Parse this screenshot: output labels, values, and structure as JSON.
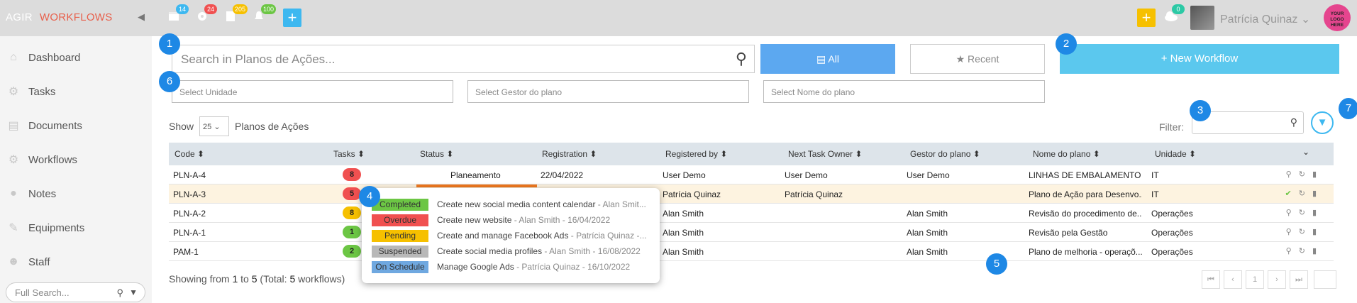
{
  "header": {
    "brand_1": "AGIR",
    "brand_2": "WORKFLOWS",
    "badges": {
      "calendar": "14",
      "settings": "24",
      "tasks": "205",
      "notifications": "100",
      "cloud": "0"
    },
    "user_name": "Patrícia Quinaz",
    "logo_text": "YOUR LOGO HERE"
  },
  "sidebar": {
    "items": [
      {
        "label": "Dashboard",
        "icon": "home-icon"
      },
      {
        "label": "Tasks",
        "icon": "gear-icon"
      },
      {
        "label": "Documents",
        "icon": "document-icon"
      },
      {
        "label": "Workflows",
        "icon": "gears-icon"
      },
      {
        "label": "Notes",
        "icon": "chat-icon"
      },
      {
        "label": "Equipments",
        "icon": "wrench-icon"
      },
      {
        "label": "Staff",
        "icon": "user-icon"
      }
    ],
    "full_search_placeholder": "Full Search..."
  },
  "toolbar": {
    "search_placeholder": "Search in Planos de Ações...",
    "all_label": "All",
    "recent_label": "Recent",
    "new_workflow_label": "+ New Workflow",
    "filters": [
      "Select Unidade",
      "Select Gestor do plano",
      "Select Nome do plano"
    ],
    "show_label": "Show",
    "page_size": "25",
    "entity_label": "Planos de Ações",
    "filter_label": "Filter:"
  },
  "table": {
    "columns": [
      "Code",
      "Tasks",
      "Status",
      "Registration",
      "Registered by",
      "Next Task Owner",
      "Gestor do plano",
      "Nome do plano",
      "Unidade"
    ],
    "rows": [
      {
        "code": "PLN-A-4",
        "tasks": "8",
        "task_color": "#f05050",
        "status": "Planeamento",
        "registration": "22/04/2022",
        "registered_by": "User Demo",
        "next_owner": "User Demo",
        "gestor": "User Demo",
        "nome": "LINHAS DE EMBALAMENTO ...",
        "unidade": "IT"
      },
      {
        "code": "PLN-A-3",
        "tasks": "5",
        "task_color": "#f05050",
        "status": "",
        "registration": "",
        "registered_by": "Patrícia Quinaz",
        "next_owner": "Patrícia Quinaz",
        "gestor": "",
        "nome": "Plano de Ação para Desenvo...",
        "unidade": "IT"
      },
      {
        "code": "PLN-A-2",
        "tasks": "8",
        "task_color": "#f6c000",
        "status": "",
        "registration": "",
        "registered_by": "Alan Smith",
        "next_owner": "",
        "gestor": "Alan Smith",
        "nome": "Revisão do procedimento de...",
        "unidade": "Operações"
      },
      {
        "code": "PLN-A-1",
        "tasks": "1",
        "task_color": "#6cc644",
        "status": "",
        "registration": "",
        "registered_by": "Alan Smith",
        "next_owner": "",
        "gestor": "Alan Smith",
        "nome": "Revisão pela Gestão",
        "unidade": "Operações"
      },
      {
        "code": "PAM-1",
        "tasks": "2",
        "task_color": "#6cc644",
        "status": "",
        "registration": "",
        "registered_by": "Alan Smith",
        "next_owner": "",
        "gestor": "Alan Smith",
        "nome": "Plano de melhoria - operaçõ...",
        "unidade": "Operações"
      }
    ],
    "showing_prefix": "Showing from ",
    "showing_from": "1",
    "showing_to_word": " to ",
    "showing_to": "5",
    "showing_total_prefix": " (Total: ",
    "showing_total": "5",
    "showing_suffix": " workflows)",
    "current_page": "1"
  },
  "popup": {
    "items": [
      {
        "status": "Completed",
        "color": "#6cc644",
        "task": "Create new social media content calendar",
        "meta": " - Alan Smit..."
      },
      {
        "status": "Overdue",
        "color": "#f05050",
        "task": "Create new website",
        "meta": " - Alan Smith - 16/04/2022"
      },
      {
        "status": "Pending",
        "color": "#f6c000",
        "task": "Create and manage Facebook Ads",
        "meta": " - Patrícia Quinaz -..."
      },
      {
        "status": "Suspended",
        "color": "#b8b8b8",
        "task": "Create social media profiles",
        "meta": " - Alan Smith - 16/08/2022"
      },
      {
        "status": "On Schedule",
        "color": "#6fa8e0",
        "task": "Manage Google Ads",
        "meta": " - Patrícia Quinaz - 16/10/2022"
      }
    ]
  },
  "markers": [
    "1",
    "2",
    "3",
    "4",
    "5",
    "6",
    "7"
  ]
}
